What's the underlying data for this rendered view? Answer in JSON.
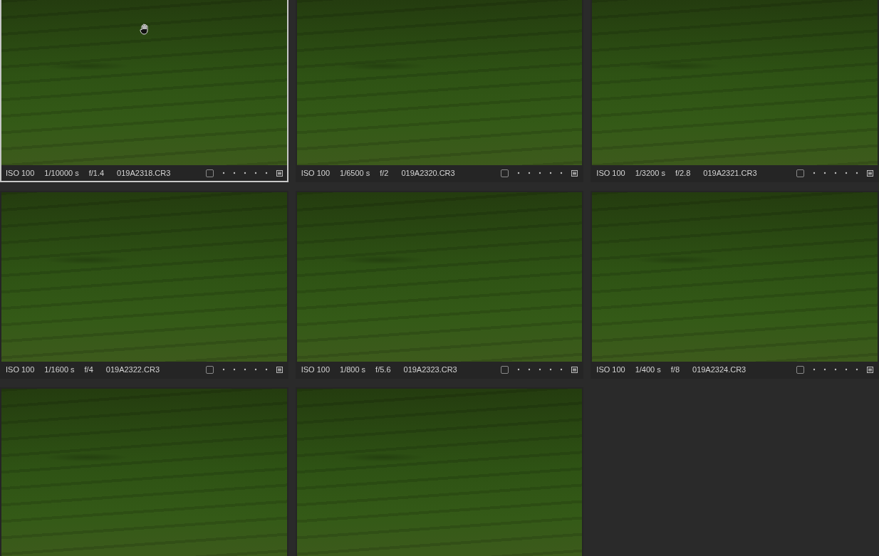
{
  "thumbnails": [
    {
      "selected": true,
      "info": {
        "iso": "ISO 100",
        "shutter": "1/10000 s",
        "aperture": "f/1.4",
        "filename": "019A2318.CR3",
        "checked": false
      }
    },
    {
      "selected": false,
      "info": {
        "iso": "ISO 100",
        "shutter": "1/6500 s",
        "aperture": "f/2",
        "filename": "019A2320.CR3",
        "checked": false
      }
    },
    {
      "selected": false,
      "info": {
        "iso": "ISO 100",
        "shutter": "1/3200 s",
        "aperture": "f/2.8",
        "filename": "019A2321.CR3",
        "checked": false
      }
    },
    {
      "selected": false,
      "info": {
        "iso": "ISO 100",
        "shutter": "1/1600 s",
        "aperture": "f/4",
        "filename": "019A2322.CR3",
        "checked": false
      }
    },
    {
      "selected": false,
      "info": {
        "iso": "ISO 100",
        "shutter": "1/800 s",
        "aperture": "f/5.6",
        "filename": "019A2323.CR3",
        "checked": false
      }
    },
    {
      "selected": false,
      "info": {
        "iso": "ISO 100",
        "shutter": "1/400 s",
        "aperture": "f/8",
        "filename": "019A2324.CR3",
        "checked": false
      }
    },
    {
      "selected": false
    },
    {
      "selected": false
    }
  ]
}
